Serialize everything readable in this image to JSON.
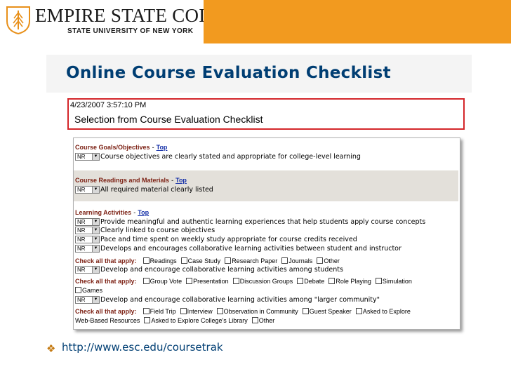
{
  "header": {
    "college_name": "Empire State College",
    "college_name_display": "EMPIRE STATE COLLEGE",
    "university": "STATE UNIVERSITY OF NEW YORK",
    "band_color": "#f29a1f"
  },
  "slide": {
    "title": "Online Course Evaluation Checklist",
    "title_color": "#003e73"
  },
  "selection": {
    "timestamp": "4/23/2007 3:57:10 PM",
    "title": "Selection from Course Evaluation Checklist"
  },
  "checklist": {
    "top_link": "Top",
    "dash": "-",
    "select_value": "NR",
    "check_all_label": "Check all that apply:",
    "sections": {
      "goals": {
        "header": "Course Goals/Objectives",
        "items": [
          "Course objectives are clearly stated and appropriate for college-level learning"
        ]
      },
      "readings": {
        "header": "Course Readings and Materials",
        "items": [
          "All required material clearly listed"
        ]
      },
      "activities": {
        "header": "Learning Activities",
        "items": [
          "Provide meaningful and authentic learning experiences that help students apply course concepts",
          "Clearly linked to course objectives",
          "Pace and time spent on weekly study appropriate for course credits received",
          "Develops and encourages collaborative learning activities between student and instructor"
        ],
        "check1": [
          "Readings",
          "Case Study",
          "Research Paper",
          "Journals",
          "Other"
        ],
        "item5": "Develop and encourage collaborative learning activities among students",
        "check2": [
          "Group Vote",
          "Presentation",
          "Discussion Groups",
          "Debate",
          "Role Playing",
          "Simulation"
        ],
        "check2_wrap": "Games",
        "item6": "Develop and encourage collaborative learning activities among \"larger community\"",
        "check3": [
          "Field Trip",
          "Interview",
          "Observation in Community",
          "Guest Speaker",
          "Asked to Explore"
        ],
        "check3_wrap_text": "Web-Based Resources",
        "check3_wrap": [
          "Asked to Explore College's Library",
          "Other"
        ]
      }
    }
  },
  "link": {
    "bullet_icon": "diamond-bullet-icon",
    "url": "http://www.esc.edu/coursetrak"
  }
}
